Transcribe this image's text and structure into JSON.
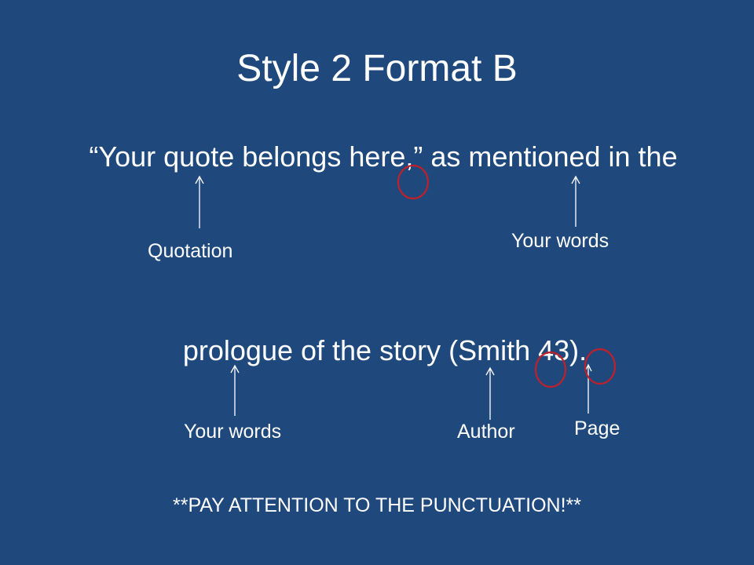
{
  "slide": {
    "title": "Style 2 Format B",
    "line1": "“Your quote belongs here,” as mentioned in the",
    "line2": "prologue of the story (Smith 43).",
    "labels": {
      "quotation": "Quotation",
      "your_words_1": "Your words",
      "your_words_2": "Your words",
      "author": "Author",
      "page": "Page"
    },
    "note": "**PAY ATTENTION TO THE PUNCTUATION!**"
  },
  "colors": {
    "background": "#1f497d",
    "text": "#ffffff",
    "circle": "#c0202a"
  }
}
